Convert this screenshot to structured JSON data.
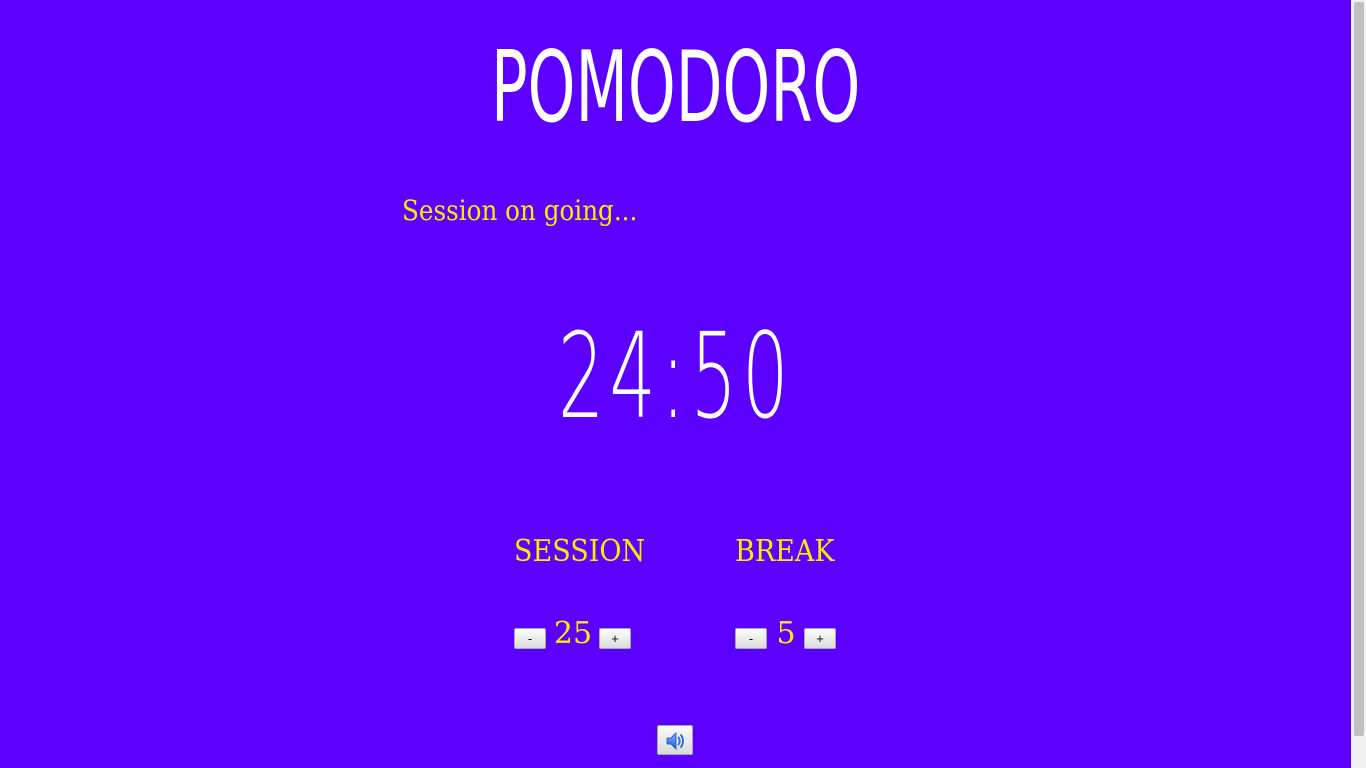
{
  "app": {
    "title": "POMODORO",
    "status": "Session on going...",
    "timer": "24:50"
  },
  "session": {
    "label": "SESSION",
    "value": "25",
    "decrement_label": "-",
    "increment_label": "+"
  },
  "break": {
    "label": "BREAK",
    "value": "5",
    "decrement_label": "-",
    "increment_label": "+"
  },
  "sound": {
    "icon": "speaker-icon"
  },
  "colors": {
    "background": "#5c00ff",
    "accent": "#ffea00",
    "text_primary": "#ffffff"
  }
}
